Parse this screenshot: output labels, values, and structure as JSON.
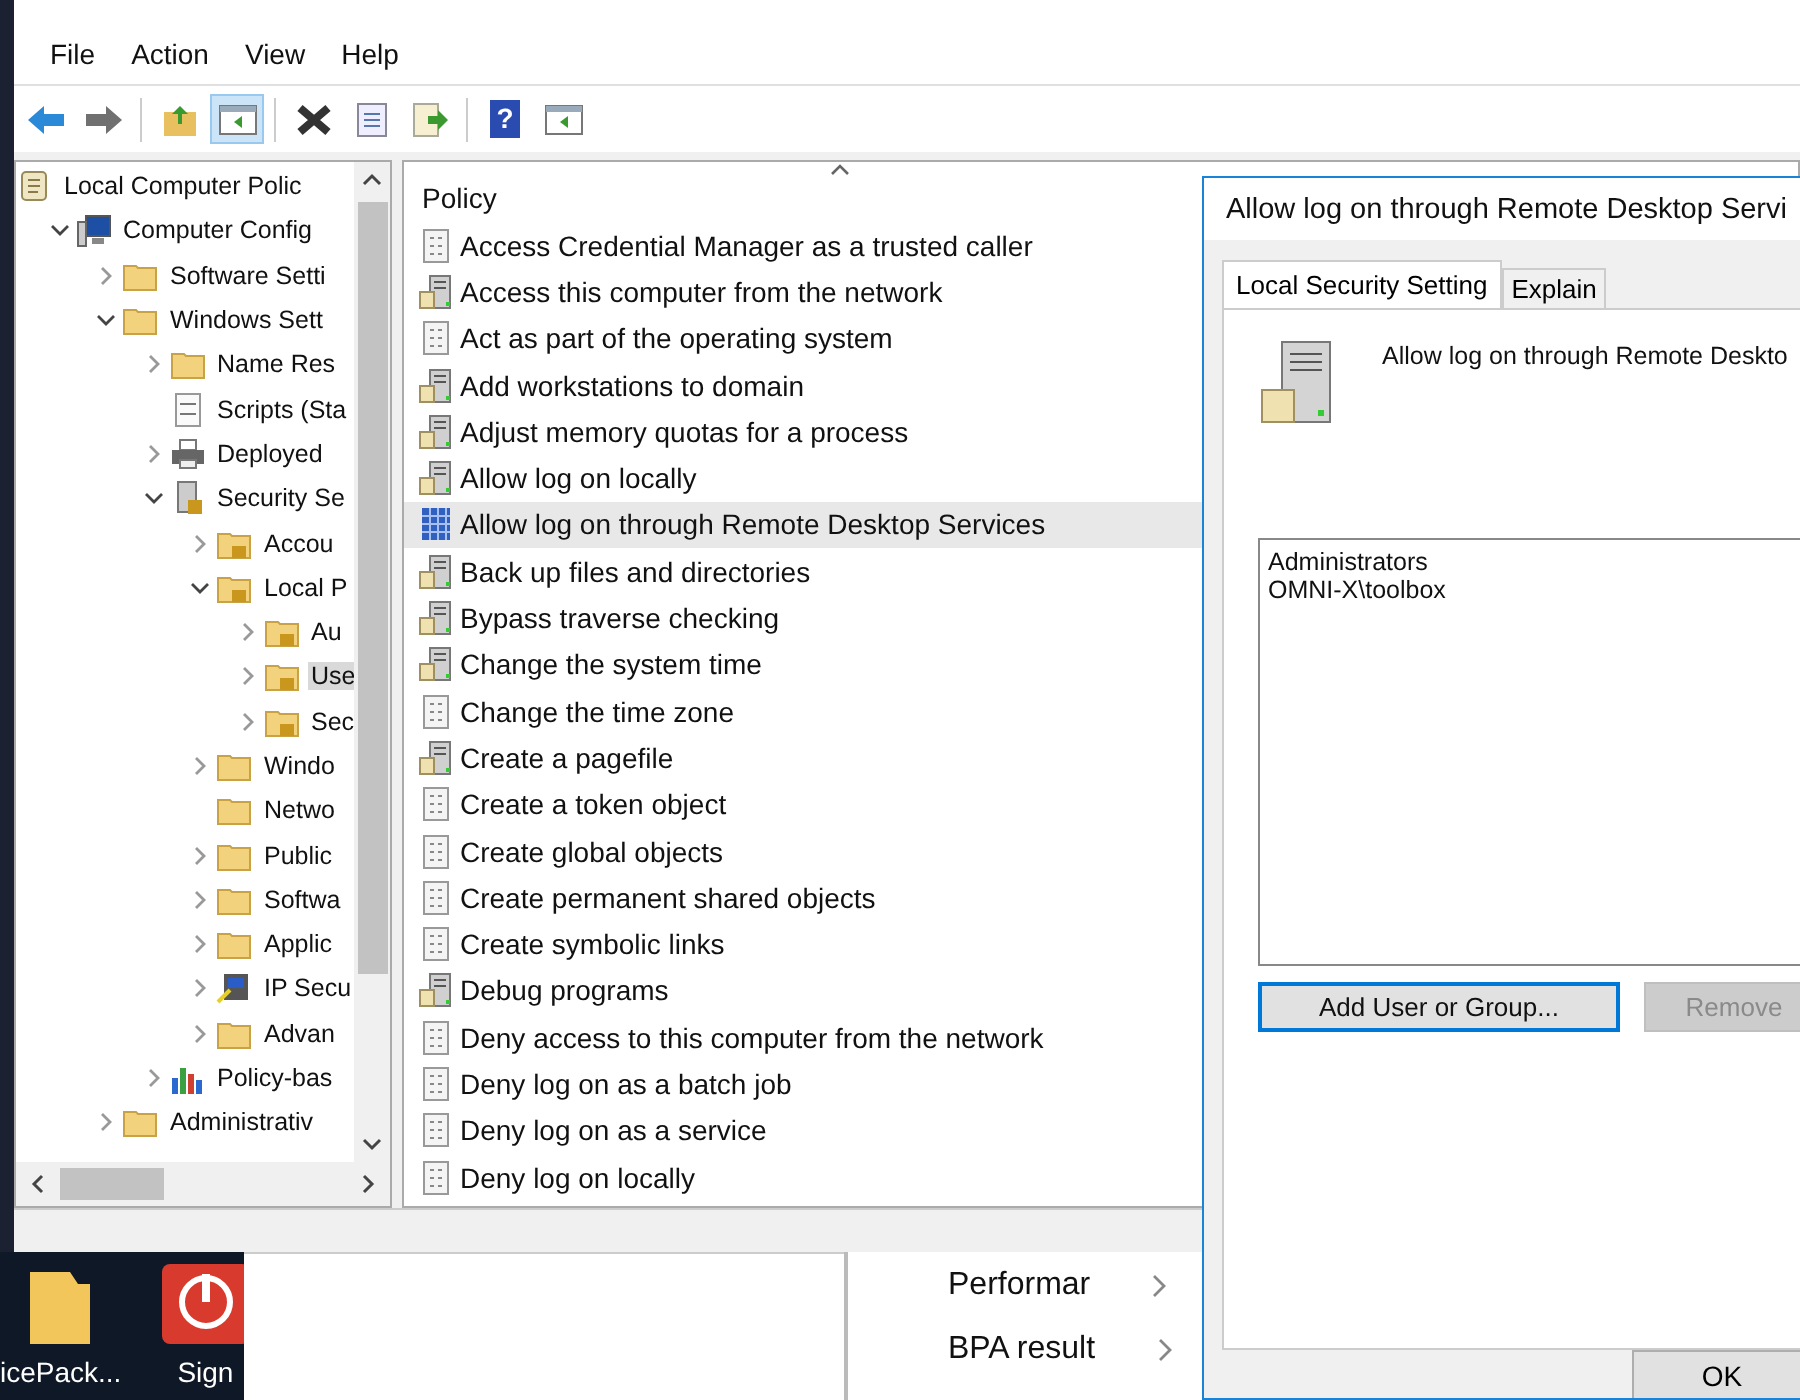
{
  "menu": [
    "File",
    "Action",
    "View",
    "Help"
  ],
  "toolbar": [
    {
      "kind": "back",
      "pressed": false
    },
    {
      "kind": "forward",
      "pressed": false
    },
    {
      "kind": "up",
      "pressed": false
    },
    {
      "kind": "pane",
      "pressed": true
    },
    {
      "kind": "delete",
      "pressed": false
    },
    {
      "kind": "properties",
      "pressed": false
    },
    {
      "kind": "export",
      "pressed": false
    },
    {
      "kind": "help",
      "pressed": false,
      "glyph": "?"
    },
    {
      "kind": "pane2",
      "pressed": false
    }
  ],
  "tree": [
    {
      "label": "Local Computer Polic",
      "kind": "scroll",
      "selected": false,
      "children": [
        {
          "label": "Computer Config",
          "kind": "computer",
          "expanded": true,
          "selected": false,
          "children": [
            {
              "label": "Software Setti",
              "kind": "folder",
              "expanded": false,
              "selected": false
            },
            {
              "label": "Windows Sett",
              "kind": "folder",
              "expanded": true,
              "selected": false,
              "children": [
                {
                  "label": "Name Res",
                  "kind": "folder",
                  "expanded": false,
                  "selected": false
                },
                {
                  "label": "Scripts (Sta",
                  "kind": "script",
                  "selected": false
                },
                {
                  "label": "Deployed",
                  "kind": "printer",
                  "expanded": false,
                  "selected": false
                },
                {
                  "label": "Security Se",
                  "kind": "server-lock",
                  "expanded": true,
                  "selected": false,
                  "children": [
                    {
                      "label": "Accou",
                      "kind": "folder-lock",
                      "expanded": false,
                      "selected": false
                    },
                    {
                      "label": "Local P",
                      "kind": "folder-lock",
                      "expanded": true,
                      "selected": false,
                      "children": [
                        {
                          "label": "Au",
                          "kind": "folder-lock",
                          "expanded": false,
                          "selected": false
                        },
                        {
                          "label": "Use",
                          "kind": "folder-lock",
                          "expanded": false,
                          "selected": true
                        },
                        {
                          "label": "Sec",
                          "kind": "folder-lock",
                          "expanded": false,
                          "selected": false
                        }
                      ]
                    },
                    {
                      "label": "Windo",
                      "kind": "folder",
                      "expanded": false,
                      "selected": false
                    },
                    {
                      "label": "Netwo",
                      "kind": "folder",
                      "selected": false
                    },
                    {
                      "label": "Public",
                      "kind": "folder",
                      "expanded": false,
                      "selected": false
                    },
                    {
                      "label": "Softwa",
                      "kind": "folder",
                      "expanded": false,
                      "selected": false
                    },
                    {
                      "label": "Applic",
                      "kind": "folder",
                      "expanded": false,
                      "selected": false
                    },
                    {
                      "label": "IP Secu",
                      "kind": "ipsec",
                      "expanded": false,
                      "selected": false
                    },
                    {
                      "label": "Advan",
                      "kind": "folder",
                      "expanded": false,
                      "selected": false
                    }
                  ]
                },
                {
                  "label": "Policy-bas",
                  "kind": "chart",
                  "expanded": false,
                  "selected": false
                }
              ]
            },
            {
              "label": "Administrativ",
              "kind": "folder",
              "expanded": false,
              "selected": false
            }
          ]
        }
      ]
    }
  ],
  "policy": {
    "header": "Policy",
    "rows": [
      {
        "label": "Access Credential Manager as a trusted caller",
        "kind": "binary",
        "selected": false
      },
      {
        "label": "Access this computer from the network",
        "kind": "server",
        "selected": false
      },
      {
        "label": "Act as part of the operating system",
        "kind": "binary",
        "selected": false
      },
      {
        "label": "Add workstations to domain",
        "kind": "server",
        "selected": false
      },
      {
        "label": "Adjust memory quotas for a process",
        "kind": "server",
        "selected": false
      },
      {
        "label": "Allow log on locally",
        "kind": "server",
        "selected": false
      },
      {
        "label": "Allow log on through Remote Desktop Services",
        "kind": "grid",
        "selected": true
      },
      {
        "label": "Back up files and directories",
        "kind": "server",
        "selected": false
      },
      {
        "label": "Bypass traverse checking",
        "kind": "server",
        "selected": false
      },
      {
        "label": "Change the system time",
        "kind": "server",
        "selected": false
      },
      {
        "label": "Change the time zone",
        "kind": "binary",
        "selected": false
      },
      {
        "label": "Create a pagefile",
        "kind": "server",
        "selected": false
      },
      {
        "label": "Create a token object",
        "kind": "binary",
        "selected": false
      },
      {
        "label": "Create global objects",
        "kind": "binary",
        "selected": false
      },
      {
        "label": "Create permanent shared objects",
        "kind": "binary",
        "selected": false
      },
      {
        "label": "Create symbolic links",
        "kind": "binary",
        "selected": false
      },
      {
        "label": "Debug programs",
        "kind": "server",
        "selected": false
      },
      {
        "label": "Deny access to this computer from the network",
        "kind": "binary",
        "selected": false
      },
      {
        "label": "Deny log on as a batch job",
        "kind": "binary",
        "selected": false
      },
      {
        "label": "Deny log on as a service",
        "kind": "binary",
        "selected": false
      },
      {
        "label": "Deny log on locally",
        "kind": "binary",
        "selected": false
      }
    ]
  },
  "dialog": {
    "title": "Allow log on through Remote Desktop Servi",
    "tabs": [
      {
        "label": "Local Security Setting",
        "selected": true
      },
      {
        "label": "Explain",
        "selected": false
      }
    ],
    "heading": "Allow log on through Remote Deskto",
    "members": [
      "Administrators",
      "OMNI-X\\toolbox"
    ],
    "buttons": [
      {
        "label": "Add User or Group...",
        "disabled": false,
        "focused": true
      },
      {
        "label": "Remove",
        "disabled": true,
        "focused": false
      }
    ],
    "ok": "OK"
  },
  "desktop": {
    "icons": [
      {
        "label": "icePack...",
        "kind": "folder"
      },
      {
        "label": "Sign",
        "kind": "power"
      }
    ]
  },
  "background_window": {
    "items": [
      "Performar",
      "BPA result"
    ]
  }
}
